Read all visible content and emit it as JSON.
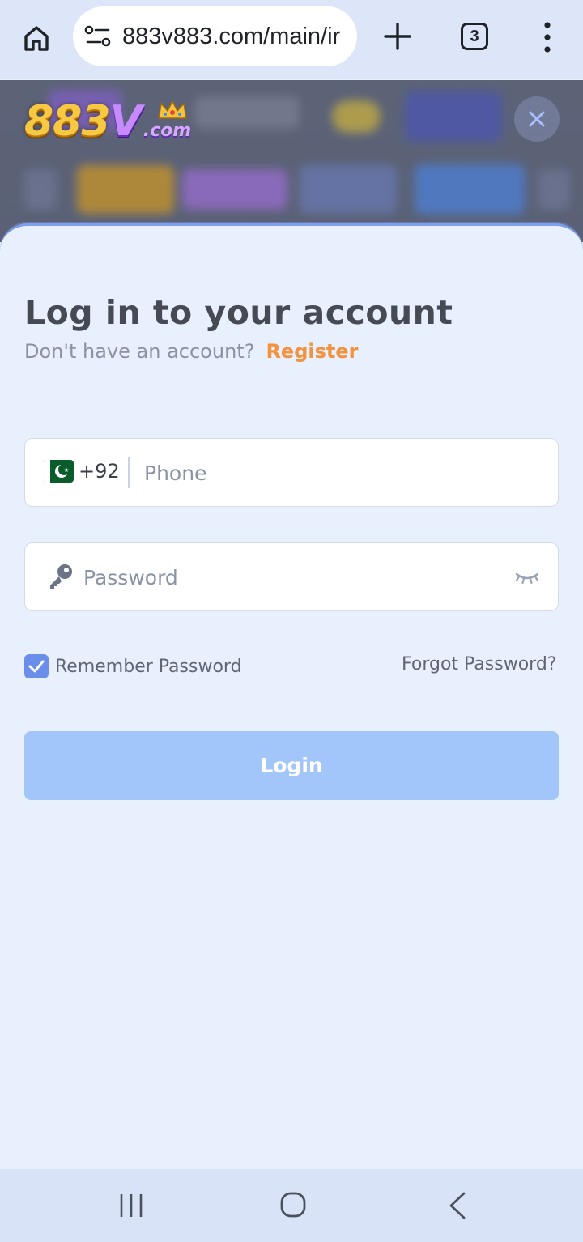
{
  "browser": {
    "url": "883v883.com/main/ir",
    "tab_count": "3"
  },
  "site": {
    "logo_text": "883",
    "logo_v": "V",
    "logo_com": ".com"
  },
  "login": {
    "title": "Log in to your account",
    "no_account_text": "Don't have an account?",
    "register_label": "Register",
    "dial_code": "+92",
    "phone_placeholder": "Phone",
    "password_placeholder": "Password",
    "remember_label": "Remember Password",
    "remember_checked": true,
    "forgot_label": "Forgot Password?",
    "login_label": "Login"
  },
  "colors": {
    "accent": "#6a8eea",
    "register": "#f3923f",
    "login_button": "#a2c6fa",
    "sheet_bg": "#e8effd"
  },
  "icons": [
    "home-icon",
    "tune-icon",
    "plus-icon",
    "tabs-icon",
    "more-vert-icon",
    "close-icon",
    "pakistan-flag-icon",
    "key-icon",
    "eye-closed-icon",
    "check-icon",
    "recents-icon",
    "home-circle-icon",
    "back-icon"
  ]
}
